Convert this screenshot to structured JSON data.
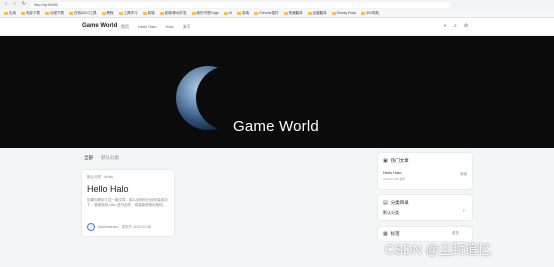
{
  "browser": {
    "url": "http://ip:8090/",
    "bookmarks": [
      "应用",
      "电影下载",
      "动漫下载",
      "在线AI/DJ工具",
      "教程",
      "工具学习",
      "前端",
      "前端/移动开发",
      "我的书签Edge",
      "AI",
      "前端",
      "Chrome插件",
      "快速翻译",
      "百度翻译",
      "Glossy Rock",
      "404导航"
    ]
  },
  "site": {
    "logo": "Game World",
    "nav": [
      "首页",
      "Hello Halo",
      "Halo",
      "关于"
    ]
  },
  "hero": {
    "title": "Game World"
  },
  "tabs": [
    "全部",
    "默认分类"
  ],
  "post": {
    "meta": "默认分类 · #Halo",
    "title": "Hello Halo",
    "excerpt": "如果你看到了这一篇文章，那么证明你已经安装成功了，感谢使用 Halo 进行创作，希望能够使用愉快。",
    "author": "Administrator",
    "date": "发布于 2023-01-08"
  },
  "sidebar": {
    "hot": {
      "title": "热门文章",
      "item": "Hello Halo",
      "sub": "2023-01-08 发布",
      "badge": "阅读"
    },
    "categories": {
      "title": "分类目录",
      "item": "默认分类"
    },
    "tags": {
      "title": "标签",
      "item": "更多"
    }
  },
  "watermark": "CSDN @尘封追忆"
}
